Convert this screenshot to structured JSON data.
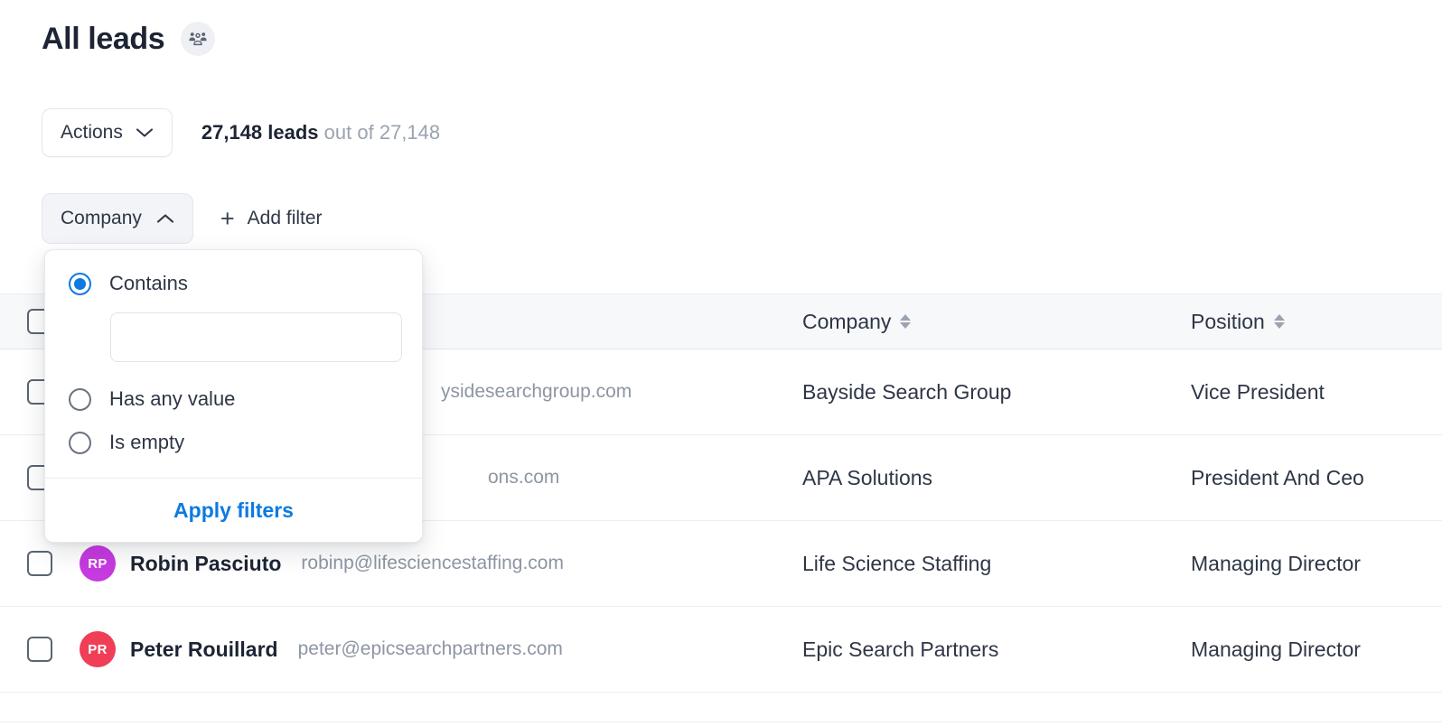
{
  "header": {
    "title": "All leads",
    "badge_icon": "people-group-icon"
  },
  "toolbar": {
    "actions_label": "Actions",
    "actions_chevron": "chevron-down-icon",
    "count_value": "27,148 leads",
    "count_suffix": "out of 27,148"
  },
  "filterbar": {
    "company_filter_label": "Company",
    "company_filter_chevron": "chevron-up-icon",
    "add_filter_label": "Add filter",
    "add_filter_icon": "plus-icon"
  },
  "filter_dropdown": {
    "options": [
      {
        "label": "Contains",
        "selected": true
      },
      {
        "label": "Has any value",
        "selected": false
      },
      {
        "label": "Is empty",
        "selected": false
      }
    ],
    "contains_value": "",
    "contains_placeholder": "",
    "apply_label": "Apply filters",
    "accent_color": "#0d7ae0"
  },
  "table": {
    "columns": [
      {
        "key": "select",
        "label": "",
        "sortable": false
      },
      {
        "key": "name",
        "label": "",
        "sortable": false
      },
      {
        "key": "company",
        "label": "Company",
        "sortable": true
      },
      {
        "key": "position",
        "label": "Position",
        "sortable": true
      }
    ],
    "rows": [
      {
        "name": "",
        "email": "ysidesearchgroup.com",
        "initials": "",
        "avatar_color": "#ffffff",
        "company": "Bayside Search Group",
        "position": "Vice President",
        "obscured": true
      },
      {
        "name": "",
        "email": "ons.com",
        "initials": "",
        "avatar_color": "#ffffff",
        "company": "APA Solutions",
        "position": "President And Ceo",
        "obscured": true
      },
      {
        "name": "Robin Pasciuto",
        "email": "robinp@lifesciencestaffing.com",
        "initials": "RP",
        "avatar_color": "#c63ae0",
        "company": "Life Science Staffing",
        "position": "Managing Director",
        "obscured": false
      },
      {
        "name": "Peter Rouillard",
        "email": "peter@epicsearchpartners.com",
        "initials": "PR",
        "avatar_color": "#ef3e56",
        "company": "Epic Search Partners",
        "position": "Managing Director",
        "obscured": false
      }
    ]
  }
}
